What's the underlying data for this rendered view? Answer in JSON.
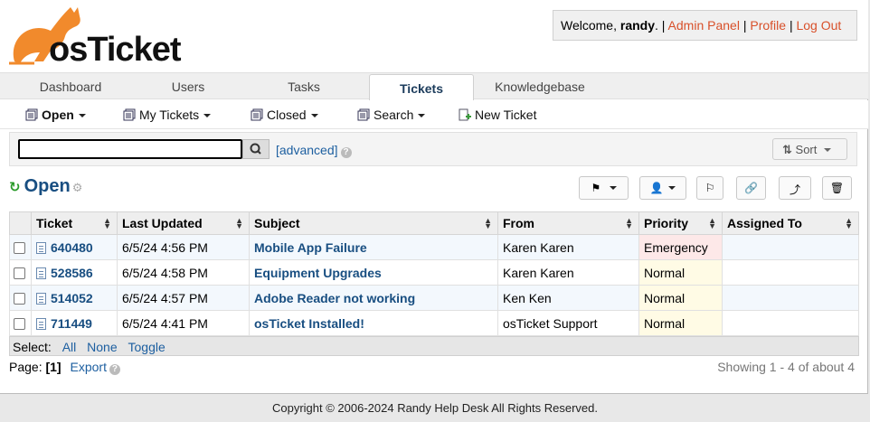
{
  "app": {
    "logo_text": "osTicket"
  },
  "user": {
    "welcome_prefix": "Welcome, ",
    "name": "randy",
    "sep1": ". |",
    "admin_panel": "Admin Panel",
    "sep2": "|",
    "profile": "Profile",
    "sep3": "|",
    "logout": "Log Out"
  },
  "nav": {
    "tabs": [
      {
        "label": "Dashboard"
      },
      {
        "label": "Users"
      },
      {
        "label": "Tasks"
      },
      {
        "label": "Tickets",
        "active": true
      },
      {
        "label": "Knowledgebase"
      }
    ]
  },
  "subnav": {
    "items": [
      {
        "label": "Open"
      },
      {
        "label": "My Tickets"
      },
      {
        "label": "Closed"
      },
      {
        "label": "Search"
      },
      {
        "label": "New Ticket"
      }
    ]
  },
  "search": {
    "value": "",
    "advanced_label": "[advanced]",
    "sort_label": "Sort"
  },
  "queue": {
    "title": "Open"
  },
  "table": {
    "columns": [
      "Ticket",
      "Last Updated",
      "Subject",
      "From",
      "Priority",
      "Assigned To"
    ],
    "rows": [
      {
        "ticket": "640480",
        "updated": "6/5/24 4:56 PM",
        "subject": "Mobile App Failure",
        "from": "Karen Karen",
        "priority": "Emergency",
        "assigned": ""
      },
      {
        "ticket": "528586",
        "updated": "6/5/24 4:58 PM",
        "subject": "Equipment Upgrades",
        "from": "Karen Karen",
        "priority": "Normal",
        "assigned": ""
      },
      {
        "ticket": "514052",
        "updated": "6/5/24 4:57 PM",
        "subject": "Adobe Reader not working",
        "from": "Ken Ken",
        "priority": "Normal",
        "assigned": ""
      },
      {
        "ticket": "711449",
        "updated": "6/5/24 4:41 PM",
        "subject": "osTicket Installed!",
        "from": "osTicket Support",
        "priority": "Normal",
        "assigned": ""
      }
    ]
  },
  "selection": {
    "label": "Select:",
    "all": "All",
    "none": "None",
    "toggle": "Toggle"
  },
  "pager": {
    "label": "Page:",
    "current": "[1]",
    "export": "Export",
    "showing": "Showing 1 - 4 of about 4"
  },
  "footer": {
    "copyright": "Copyright © 2006-2024 Randy Help Desk All Rights Reserved."
  },
  "colors": {
    "accent": "#184e81",
    "brand": "#f18a2c",
    "link": "#d8502a",
    "emergency": "#fde8e8",
    "normal": "#fffbe5"
  }
}
